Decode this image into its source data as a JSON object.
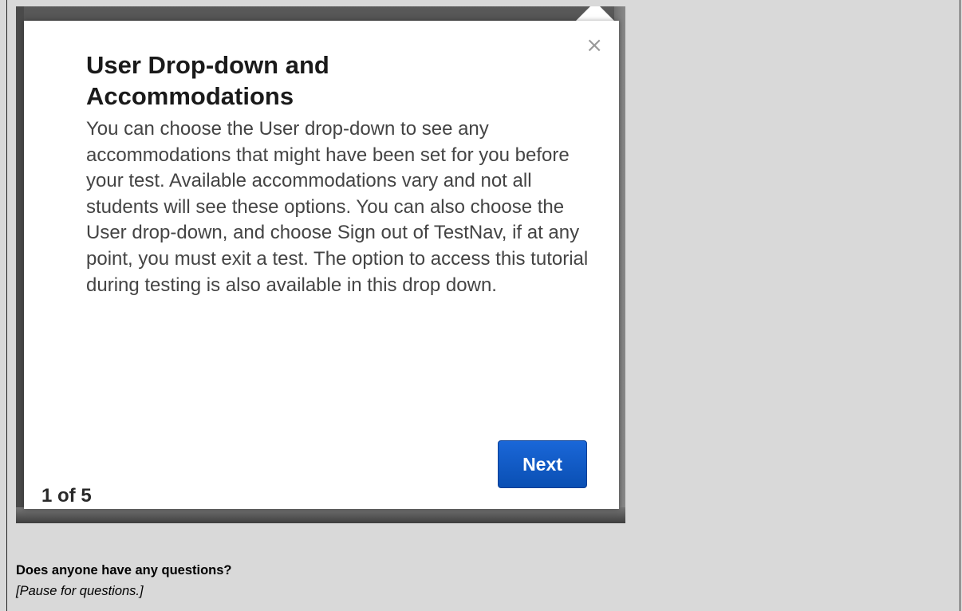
{
  "tooltip": {
    "close_glyph": "×",
    "title": "User Drop-down and Accommodations",
    "body": "You can choose the User drop-down to see any accommodations that might have been set for you before your test. Available accommodations vary and not all students will see these options. You can also choose the User drop-down, and choose Sign out of TestNav, if at any point, you must exit a test. The option to access this tutorial during testing is also available in this drop down.",
    "next_label": "Next",
    "step_counter": "1 of 5",
    "next_button_color": "#1a67d8"
  },
  "script_notes": {
    "question": "Does anyone have any questions?",
    "pause": "[Pause for questions.]"
  }
}
